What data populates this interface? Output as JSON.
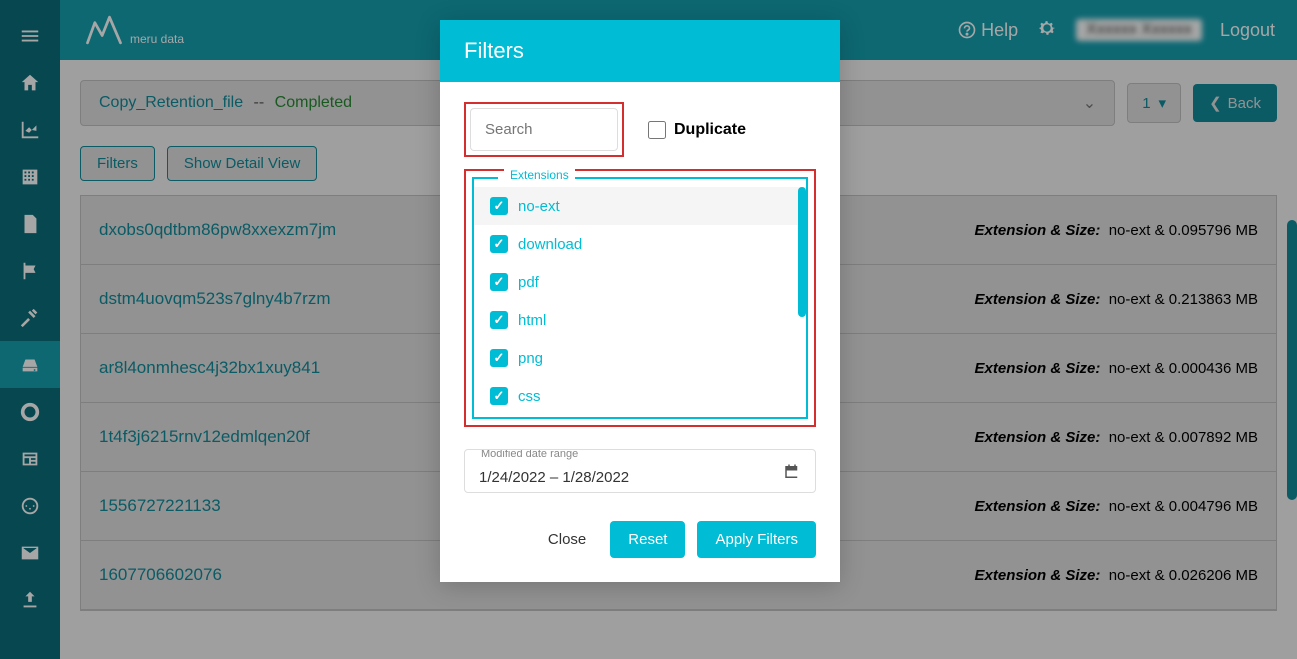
{
  "brand": {
    "name": "meru data"
  },
  "topbar": {
    "help": "Help",
    "username": "Xxxxxx Xxxxxx",
    "logout": "Logout"
  },
  "breadcrumb": {
    "name": "Copy_Retention_file",
    "sep": "--",
    "status": "Completed"
  },
  "page_selector": "1",
  "back_label": "Back",
  "actions": {
    "filters": "Filters",
    "detail": "Show Detail View"
  },
  "table": {
    "ext_label": "Extension & Size:",
    "rows": [
      {
        "name": "dxobs0qdtbm86pw8xxexzm7jm",
        "ext": "no-ext",
        "size": "0.095796 MB"
      },
      {
        "name": "dstm4uovqm523s7glny4b7rzm",
        "ext": "no-ext",
        "size": "0.213863 MB"
      },
      {
        "name": "ar8l4onmhesc4j32bx1xuy841",
        "ext": "no-ext",
        "size": "0.000436 MB"
      },
      {
        "name": "1t4f3j6215rnv12edmlqen20f",
        "ext": "no-ext",
        "size": "0.007892 MB"
      },
      {
        "name": "1556727221133",
        "ext": "no-ext",
        "size": "0.004796 MB"
      },
      {
        "name": "1607706602076",
        "ext": "no-ext",
        "size": "0.026206 MB"
      }
    ]
  },
  "modal": {
    "title": "Filters",
    "search_placeholder": "Search",
    "duplicate_label": "Duplicate",
    "extensions_label": "Extensions",
    "extensions": [
      "no-ext",
      "download",
      "pdf",
      "html",
      "png",
      "css"
    ],
    "date_label": "Modified date range",
    "date_value": "1/24/2022 – 1/28/2022",
    "close": "Close",
    "reset": "Reset",
    "apply": "Apply Filters"
  }
}
